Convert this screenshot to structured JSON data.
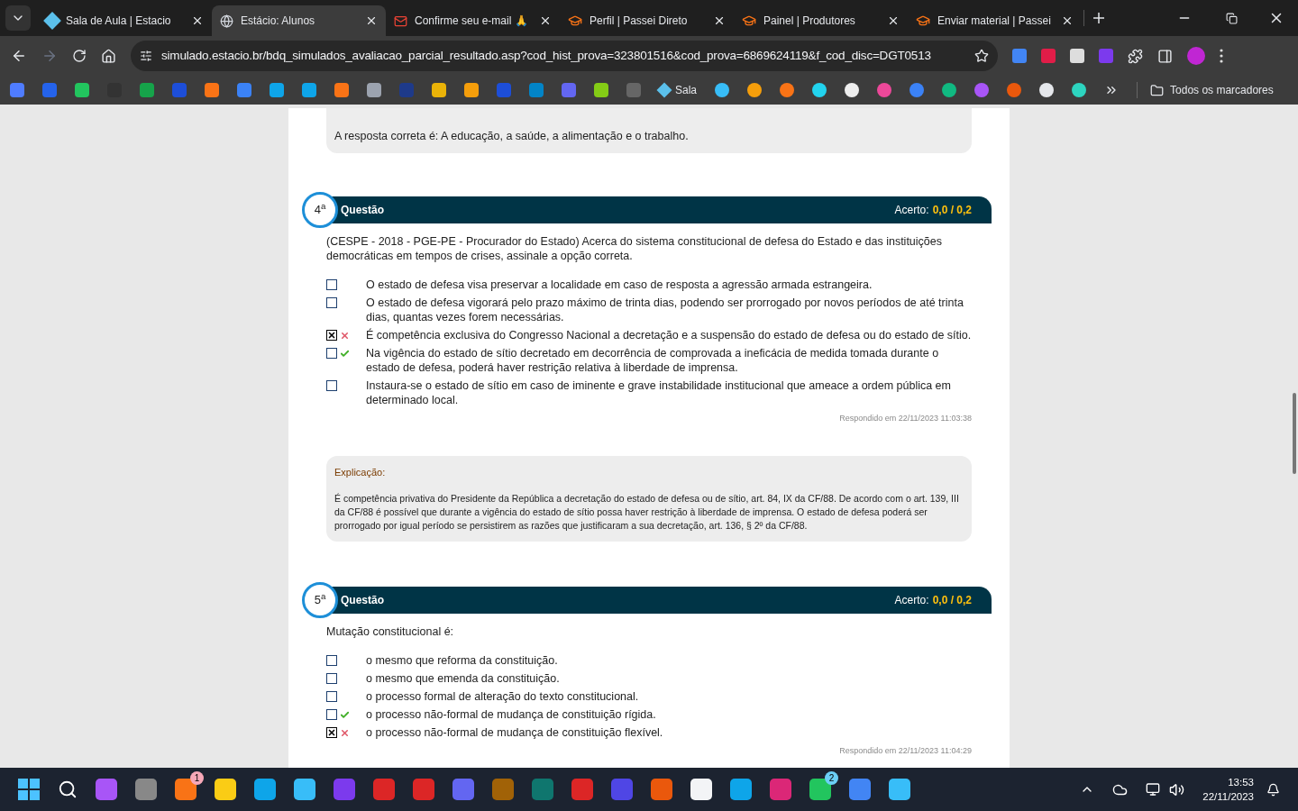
{
  "tabs": [
    {
      "title": "Sala de Aula | Estacio",
      "selected": false
    },
    {
      "title": "Estácio: Alunos",
      "selected": true
    },
    {
      "title": "Confirme seu e-mail 🙏",
      "selected": false
    },
    {
      "title": "Perfil | Passei Direto",
      "selected": false
    },
    {
      "title": "Painel | Produtores",
      "selected": false
    },
    {
      "title": "Enviar material | Passei",
      "selected": false
    }
  ],
  "address": {
    "url": "simulado.estacio.br/bdq_simulados_avaliacao_parcial_resultado.asp?cod_hist_prova=323801516&cod_prova=6869624119&f_cod_disc=DGT0513"
  },
  "bookmarks": {
    "labeled": "Sala",
    "all": "Todos os marcadores"
  },
  "previous_explanation": {
    "text": "A resposta correta é: A educação, a saúde, a alimentação e o trabalho."
  },
  "questions": [
    {
      "number": "4$^{a}$",
      "title": "Questão",
      "score_label": "Acerto:",
      "score": "0,0 / 0,2",
      "statement": "(CESPE - 2018 - PGE-PE - Procurador do Estado) Acerca do sistema constitucional de defesa do Estado e das instituições democráticas em tempos de crises, assinale a opção correta.",
      "options": [
        {
          "text": "O estado de defesa visa preservar a localidade em caso de resposta a agressão armada estrangeira.",
          "checked": false,
          "kind": "plain"
        },
        {
          "text": "O estado de defesa vigorará pelo prazo máximo de trinta dias, podendo ser prorrogado por novos períodos de até trinta dias, quantas vezes forem necessárias.",
          "checked": false,
          "kind": "plain"
        },
        {
          "text": "É competência exclusiva do Congresso Nacional a decretação e a suspensão do estado de defesa ou do estado de sítio.",
          "checked": true,
          "kind": "wrong"
        },
        {
          "text": "Na vigência do estado de sítio decretado em decorrência de comprovada a ineficácia de medida tomada durante o estado de defesa, poderá haver restrição relativa à liberdade de imprensa.",
          "checked": false,
          "kind": "correct"
        },
        {
          "text": "Instaura-se o estado de sítio em caso de iminente e grave instabilidade institucional que ameace a ordem pública em determinado local.",
          "checked": false,
          "kind": "plain"
        }
      ],
      "answered": "Respondido em 22/11/2023 11:03:38",
      "explanation": {
        "label": "Explicação:",
        "text": "É competência privativa do Presidente da República a decretação do estado de defesa ou de sítio, art. 84, IX da CF/88. De acordo com o art. 139, III da CF/88 é possível que durante a vigência do estado de sítio possa haver restrição à liberdade de imprensa. O estado de defesa poderá ser prorrogado por igual período se persistirem as razões que justificaram a sua decretação, art. 136, § 2º da CF/88."
      }
    },
    {
      "number": "5$^{a}$",
      "title": "Questão",
      "score_label": "Acerto:",
      "score": "0,0 / 0,2",
      "statement": "Mutação constitucional é:",
      "options": [
        {
          "text": "o mesmo que reforma da constituição.",
          "checked": false,
          "kind": "plain"
        },
        {
          "text": "o mesmo que emenda da constituição.",
          "checked": false,
          "kind": "plain"
        },
        {
          "text": "o processo formal de alteração do texto constitucional.",
          "checked": false,
          "kind": "plain"
        },
        {
          "text": "o processo não-formal de mudança de constituição rígida.",
          "checked": false,
          "kind": "correct"
        },
        {
          "text": "o processo não-formal de mudança de constituição flexível.",
          "checked": true,
          "kind": "wrong"
        }
      ],
      "answered": "Respondido em 22/11/2023 11:04:29"
    }
  ],
  "taskbar": {
    "badges": [
      "1",
      "2"
    ],
    "time": "13:53",
    "date": "22/11/2023"
  }
}
